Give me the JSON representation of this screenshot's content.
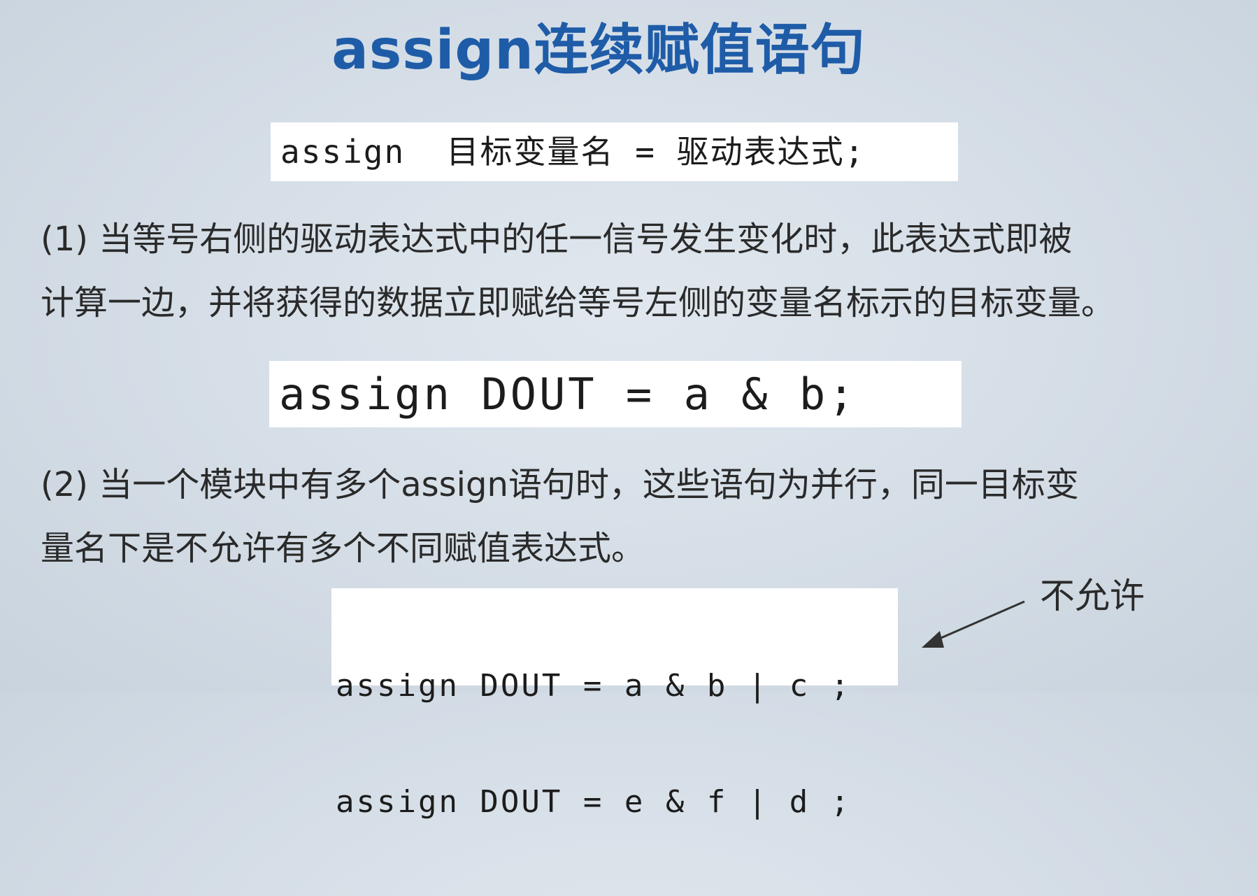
{
  "title": "assign连续赋值语句",
  "syntax": "assign  目标变量名 = 驱动表达式;",
  "point1": {
    "line1": "(1) 当等号右侧的驱动表达式中的任一信号发生变化时，此表达式即被",
    "line2": "计算一边，并将获得的数据立即赋给等号左侧的变量名标示的目标变量。"
  },
  "example1": "assign DOUT = a & b;",
  "point2": {
    "line1": "(2) 当一个模块中有多个assign语句时，这些语句为并行，同一目标变",
    "line2": "量名下是不允许有多个不同赋值表达式。"
  },
  "example2": [
    "assign DOUT = a & b | c ;",
    "assign DOUT = e & f | d ;"
  ],
  "annotation": "不允许",
  "colors": {
    "title": "#1f5ca8",
    "background": "#d4dde6",
    "code_bg": "#ffffff",
    "text": "#2a2a2a"
  }
}
